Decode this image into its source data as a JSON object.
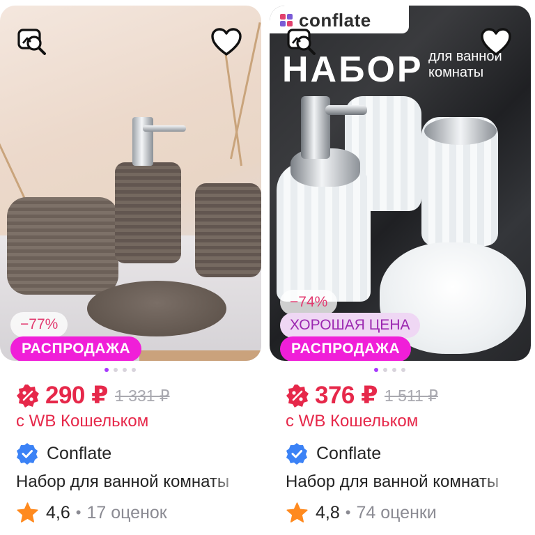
{
  "products": [
    {
      "discount": "−77%",
      "sale_label": "РАСПРОДАЖА",
      "price": "290 ₽",
      "old_price": "1 331 ₽",
      "wallet_text": "с WB Кошельком",
      "brand": "Conflate",
      "title": "Набор для ванной комнаты",
      "rating": "4,6",
      "reviews": "17 оценок",
      "image_count": 4,
      "active_image": 1
    },
    {
      "discount": "−74%",
      "promo_label": "ХОРОШАЯ ЦЕНА",
      "sale_label": "РАСПРОДАЖА",
      "price": "376 ₽",
      "old_price": "1 511 ₽",
      "wallet_text": "с WB Кошельком",
      "brand": "Conflate",
      "title": "Набор для ванной комнаты",
      "rating": "4,8",
      "reviews": "74 оценки",
      "image_count": 4,
      "active_image": 1,
      "image_text": {
        "logo": "conflate",
        "headline": "НАБОР",
        "subline_1": "для ванной",
        "subline_2": "комнаты"
      }
    }
  ],
  "icons": {
    "similar": "find-similar-icon",
    "favorite": "heart-icon",
    "wallet": "wallet-discount-icon",
    "verified": "verified-check-icon",
    "rating": "star-icon"
  },
  "colors": {
    "price": "#e6284a",
    "sale_badge": "#f01fd8",
    "good_price_text": "#9b27b0",
    "verified": "#3b82f6",
    "star": "#ff8a1f",
    "active_dot": "#a73afd"
  }
}
